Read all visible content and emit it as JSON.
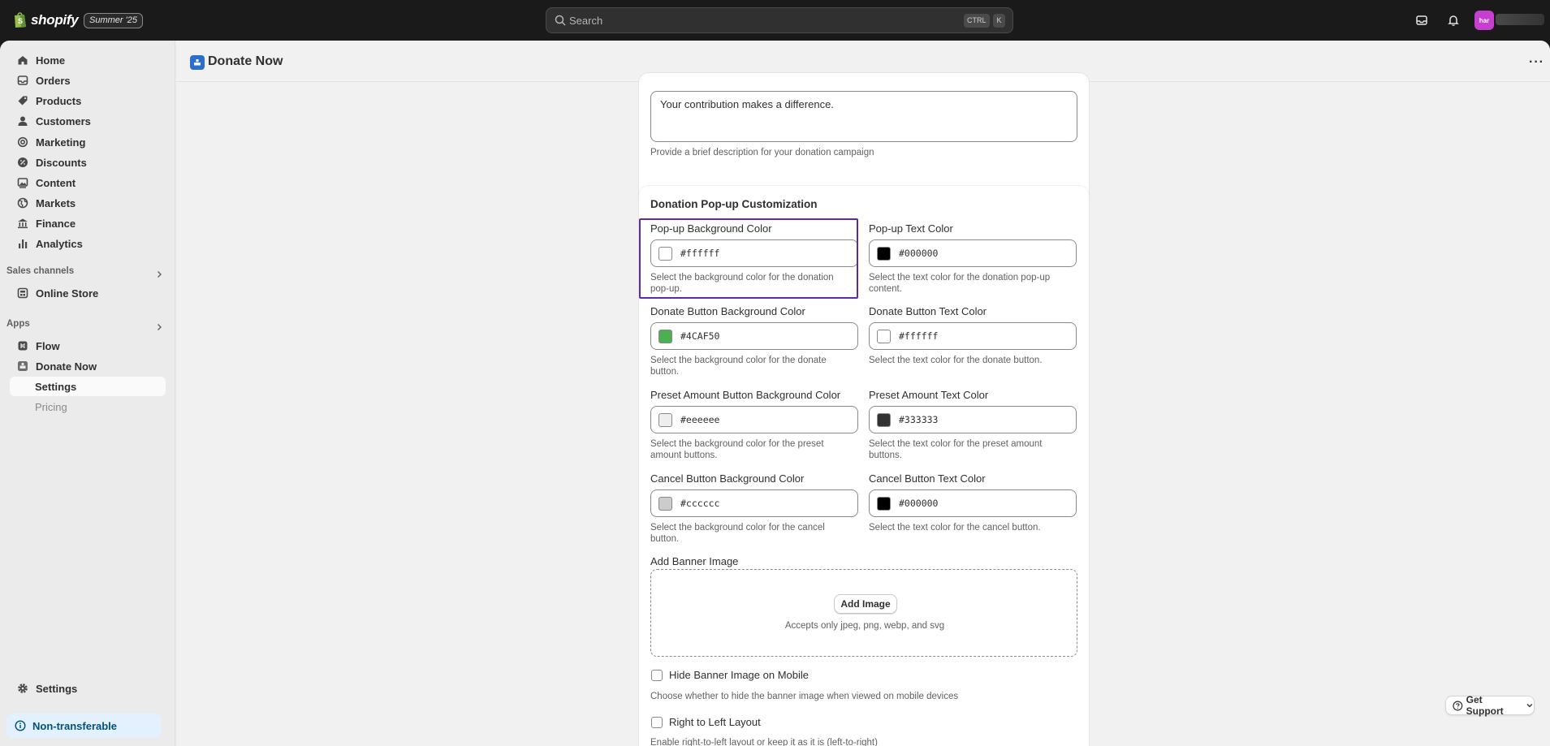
{
  "topbar": {
    "brand": "shopify",
    "edition": "Summer '25",
    "search_placeholder": "Search",
    "shortcut_ctrl": "CTRL",
    "shortcut_key": "K",
    "avatar_initials": "har"
  },
  "sidebar": {
    "items": [
      {
        "label": "Home",
        "icon": "home-icon"
      },
      {
        "label": "Orders",
        "icon": "orders-icon"
      },
      {
        "label": "Products",
        "icon": "tag-icon"
      },
      {
        "label": "Customers",
        "icon": "person-icon"
      },
      {
        "label": "Marketing",
        "icon": "target-icon"
      },
      {
        "label": "Discounts",
        "icon": "discount-icon"
      },
      {
        "label": "Content",
        "icon": "image-icon"
      },
      {
        "label": "Markets",
        "icon": "globe-icon"
      },
      {
        "label": "Finance",
        "icon": "bank-icon"
      },
      {
        "label": "Analytics",
        "icon": "bar-chart-icon"
      }
    ],
    "sales_channels_title": "Sales channels",
    "online_store": "Online Store",
    "apps_title": "Apps",
    "flow": "Flow",
    "donate_now": "Donate Now",
    "app_settings": "Settings",
    "pricing": "Pricing",
    "settings": "Settings",
    "non_transferable": "Non-transferable"
  },
  "page": {
    "title": "Donate Now",
    "description_value": "Your contribution makes a difference.",
    "description_help": "Provide a brief description for your donation campaign"
  },
  "customization": {
    "title": "Donation Pop-up Customization",
    "fields": [
      {
        "label": "Pop-up Background Color",
        "value": "#ffffff",
        "swatch": "#ffffff",
        "help1": "Select the background color for the donation",
        "help2": "pop-up."
      },
      {
        "label": "Pop-up Text Color",
        "value": "#000000",
        "swatch": "#000000",
        "help1": "Select the text color for the donation pop-up",
        "help2": "content."
      },
      {
        "label": "Donate Button Background Color",
        "value": "#4CAF50",
        "swatch": "#4CAF50",
        "help1": "Select the background color for the donate",
        "help2": "button."
      },
      {
        "label": "Donate Button Text Color",
        "value": "#ffffff",
        "swatch": "#ffffff",
        "help1": "Select the text color for the donate button.",
        "help2": ""
      },
      {
        "label": "Preset Amount Button Background Color",
        "value": "#eeeeee",
        "swatch": "#eeeeee",
        "help1": "Select the background color for the preset",
        "help2": "amount buttons."
      },
      {
        "label": "Preset Amount Text Color",
        "value": "#333333",
        "swatch": "#333333",
        "help1": "Select the text color for the preset amount",
        "help2": "buttons."
      },
      {
        "label": "Cancel Button Background Color",
        "value": "#cccccc",
        "swatch": "#cccccc",
        "help1": "Select the background color for the cancel",
        "help2": "button."
      },
      {
        "label": "Cancel Button Text Color",
        "value": "#000000",
        "swatch": "#000000",
        "help1": "Select the text color for the cancel button.",
        "help2": ""
      }
    ],
    "banner_label": "Add Banner Image",
    "add_image": "Add Image",
    "accepts": "Accepts only jpeg, png, webp, and svg",
    "hide_banner_label": "Hide Banner Image on Mobile",
    "hide_banner_help": "Choose whether to hide the banner image when viewed on mobile devices",
    "rtl_label": "Right to Left Layout",
    "rtl_help": "Enable right-to-left layout or keep it as it is (left-to-right)"
  },
  "support": {
    "label": "Get Support"
  },
  "colors": {
    "accent_highlight": "#5b2bb0",
    "info_bg": "#e3f1ff",
    "info_text": "#00527c"
  }
}
